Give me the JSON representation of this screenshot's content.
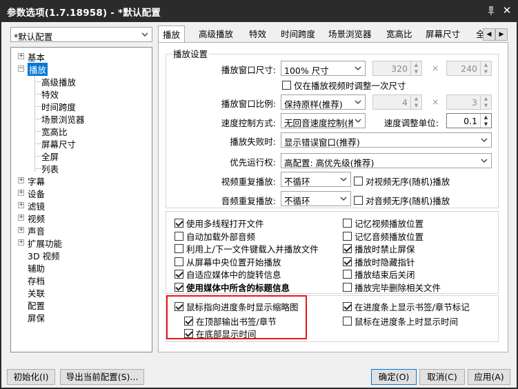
{
  "window": {
    "title": "参数选项(1.7.18958) - *默认配置"
  },
  "profile": {
    "selected": "*默认配置"
  },
  "tabs": [
    "播放",
    "高级播放",
    "特效",
    "时间跨度",
    "场景浏览器",
    "宽高比",
    "屏幕尺寸",
    "全"
  ],
  "tree": {
    "items": [
      {
        "label": "基本",
        "expander": "+"
      },
      {
        "label": "播放",
        "expander": "-",
        "selected": true
      },
      {
        "label": "高级播放"
      },
      {
        "label": "特效"
      },
      {
        "label": "时间跨度"
      },
      {
        "label": "场景浏览器"
      },
      {
        "label": "宽高比"
      },
      {
        "label": "屏幕尺寸"
      },
      {
        "label": "全屏"
      },
      {
        "label": "列表"
      },
      {
        "label": "字幕",
        "expander": "+"
      },
      {
        "label": "设备",
        "expander": "+"
      },
      {
        "label": "滤镜",
        "expander": "+"
      },
      {
        "label": "视频",
        "expander": "+"
      },
      {
        "label": "声音",
        "expander": "+"
      },
      {
        "label": "扩展功能",
        "expander": "+"
      },
      {
        "label": "3D 视频"
      },
      {
        "label": "辅助"
      },
      {
        "label": "存档"
      },
      {
        "label": "关联"
      },
      {
        "label": "配置"
      },
      {
        "label": "屏保"
      }
    ]
  },
  "playback": {
    "group_title": "播放设置",
    "window_size": {
      "label": "播放窗口尺寸:",
      "value": "100% 尺寸",
      "width": "320",
      "height": "240",
      "times": "×"
    },
    "adjust_once": {
      "label": "仅在播放视频时调整一次尺寸",
      "checked": false
    },
    "window_ratio": {
      "label": "播放窗口比例:",
      "value": "保持原样(推荐)",
      "w": "4",
      "h": "3",
      "times": "×"
    },
    "speed_mode": {
      "label": "速度控制方式:",
      "value": "无回音速度控制(推",
      "unit_label": "速度调整单位:",
      "unit_value": "0.1"
    },
    "on_fail": {
      "label": "播放失败时:",
      "value": "显示错误窗口(推荐)"
    },
    "priority": {
      "label": "优先运行权:",
      "value": "高配置: 高优先级(推荐)"
    },
    "video_repeat": {
      "label": "视频重复播放:",
      "value": "不循环",
      "shuffle_label": "对视频无序(随机)播放",
      "shuffle_checked": false
    },
    "audio_repeat": {
      "label": "音频重复播放:",
      "value": "不循环",
      "shuffle_label": "对音频无序(随机)播放",
      "shuffle_checked": false
    }
  },
  "options_left": [
    {
      "label": "使用多线程打开文件",
      "checked": true,
      "bold": false
    },
    {
      "label": "自动加载外部音频",
      "checked": false,
      "bold": false
    },
    {
      "label": "利用上/下一文件键载入并播放文件",
      "checked": false,
      "bold": false
    },
    {
      "label": "从屏幕中央位置开始播放",
      "checked": false,
      "bold": false
    },
    {
      "label": "自适应媒体中的旋转信息",
      "checked": true,
      "bold": false
    },
    {
      "label": "使用媒体中所含的标题信息",
      "checked": true,
      "bold": true
    }
  ],
  "options_right": [
    {
      "label": "记忆视频播放位置",
      "checked": false
    },
    {
      "label": "记忆音频播放位置",
      "checked": false
    },
    {
      "label": "播放时禁止屏保",
      "checked": true
    },
    {
      "label": "播放时隐藏指针",
      "checked": true
    },
    {
      "label": "播放结束后关闭",
      "checked": false
    },
    {
      "label": "播放完毕删除相关文件",
      "checked": false
    }
  ],
  "seek_thumbs": {
    "main": {
      "label": "鼠标指向进度条时显示缩略图",
      "checked": true
    },
    "top": {
      "label": "在顶部输出书签/章节",
      "checked": true
    },
    "bottom": {
      "label": "在底部显示时间",
      "checked": true
    },
    "bookmark_marks": {
      "label": "在进度条上显示书签/章节标记",
      "checked": true
    },
    "hover_time": {
      "label": "鼠标在进度条上时显示时间",
      "checked": false
    }
  },
  "buttons": {
    "reset": "初始化(I)",
    "export": "导出当前配置(S)...",
    "ok": "确定(O)",
    "cancel": "取消(C)",
    "apply": "应用(A)"
  },
  "colors": {
    "selection": "#0078d7",
    "highlight_border": "#e8141b",
    "titlebar": "#2b2b2b"
  }
}
